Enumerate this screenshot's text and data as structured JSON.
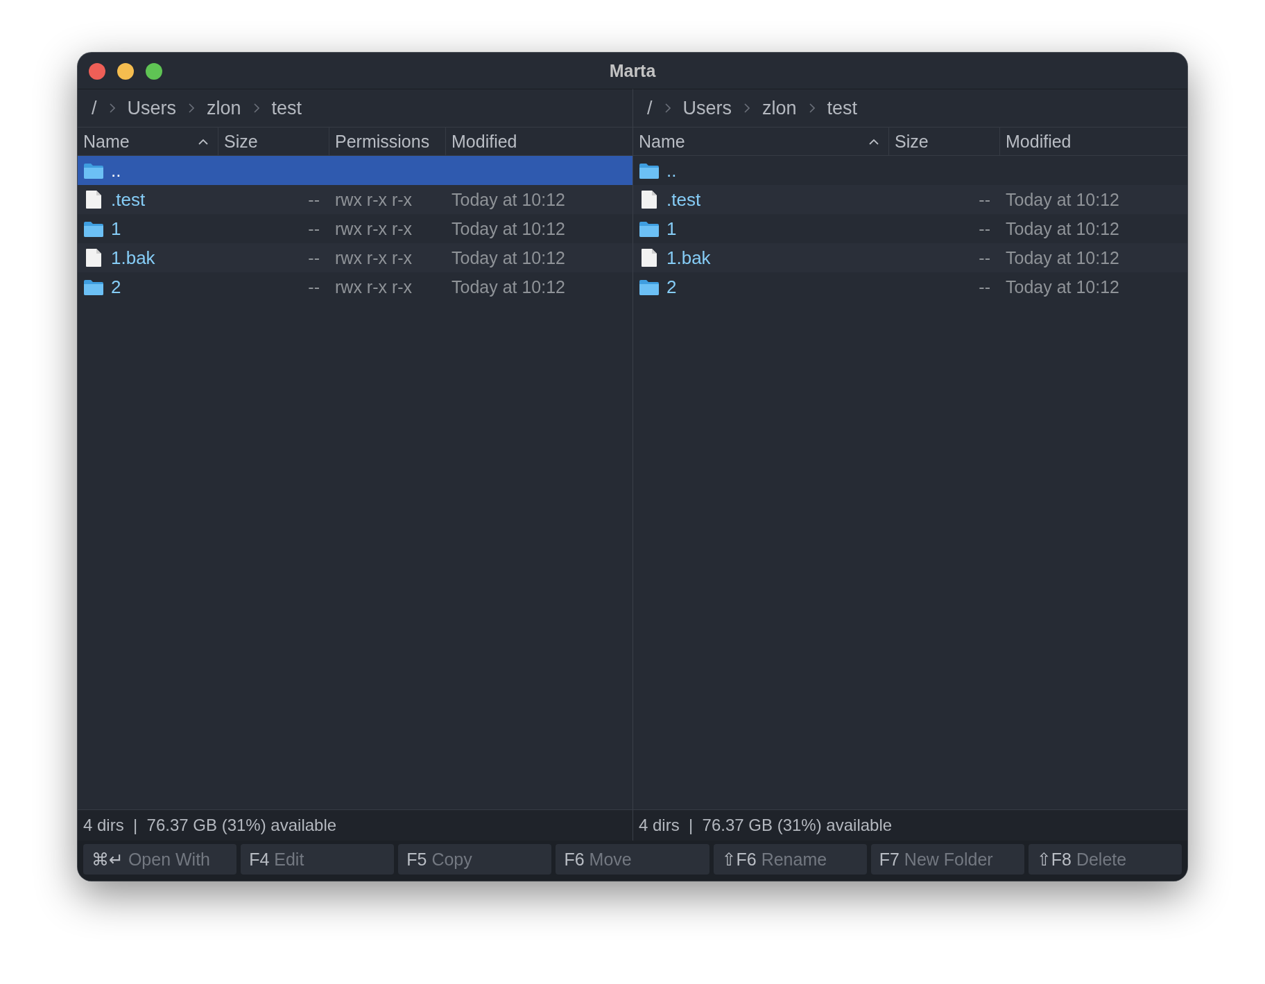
{
  "window": {
    "title": "Marta"
  },
  "panes": [
    {
      "path": [
        "/",
        "Users",
        "zlon",
        "test"
      ],
      "columns": [
        {
          "label": "Name",
          "kind": "name",
          "sorted": true
        },
        {
          "label": "Size",
          "kind": "size"
        },
        {
          "label": "Permissions",
          "kind": "permissions"
        },
        {
          "label": "Modified",
          "kind": "modified"
        }
      ],
      "rows": [
        {
          "kind": "folder",
          "name": "..",
          "selected": true
        },
        {
          "kind": "file",
          "name": ".test",
          "size": "--",
          "permissions": "rwx r-x r-x",
          "modified": "Today at 10:12",
          "selected": false
        },
        {
          "kind": "folder",
          "name": "1",
          "size": "--",
          "permissions": "rwx r-x r-x",
          "modified": "Today at 10:12",
          "selected": false
        },
        {
          "kind": "file",
          "name": "1.bak",
          "size": "--",
          "permissions": "rwx r-x r-x",
          "modified": "Today at 10:12",
          "selected": false
        },
        {
          "kind": "folder",
          "name": "2",
          "size": "--",
          "permissions": "rwx r-x r-x",
          "modified": "Today at 10:12",
          "selected": false
        }
      ],
      "status": "4 dirs  |  76.37 GB (31%) available"
    },
    {
      "path": [
        "/",
        "Users",
        "zlon",
        "test"
      ],
      "columns": [
        {
          "label": "Name",
          "kind": "name",
          "sorted": true
        },
        {
          "label": "Size",
          "kind": "size"
        },
        {
          "label": "Modified",
          "kind": "modified"
        }
      ],
      "rows": [
        {
          "kind": "folder",
          "name": "..",
          "selected": false
        },
        {
          "kind": "file",
          "name": ".test",
          "size": "--",
          "modified": "Today at 10:12",
          "selected": false
        },
        {
          "kind": "folder",
          "name": "1",
          "size": "--",
          "modified": "Today at 10:12",
          "selected": false
        },
        {
          "kind": "file",
          "name": "1.bak",
          "size": "--",
          "modified": "Today at 10:12",
          "selected": false
        },
        {
          "kind": "folder",
          "name": "2",
          "size": "--",
          "modified": "Today at 10:12",
          "selected": false
        }
      ],
      "status": "4 dirs  |  76.37 GB (31%) available"
    }
  ],
  "function_keys": [
    {
      "key": "⌘↵",
      "label": "Open With"
    },
    {
      "key": "F4",
      "label": "Edit"
    },
    {
      "key": "F5",
      "label": "Copy"
    },
    {
      "key": "F6",
      "label": "Move"
    },
    {
      "key": "⇧F6",
      "label": "Rename"
    },
    {
      "key": "F7",
      "label": "New Folder"
    },
    {
      "key": "⇧F8",
      "label": "Delete"
    }
  ]
}
